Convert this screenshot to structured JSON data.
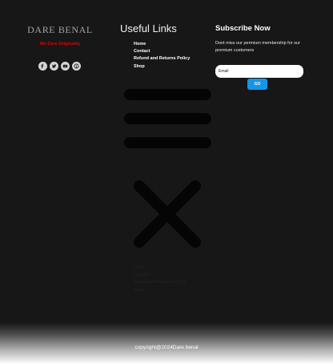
{
  "brand": {
    "name": "DARE BENAL",
    "tagline": "We Dare Originality"
  },
  "socials": [
    {
      "icon": "facebook-icon"
    },
    {
      "icon": "twitter-icon"
    },
    {
      "icon": "youtube-icon"
    },
    {
      "icon": "pinterest-icon"
    }
  ],
  "links": {
    "title": "Useful Links",
    "items": [
      {
        "label": "Home"
      },
      {
        "label": "Contact"
      },
      {
        "label": "Refund and Returns Policy"
      },
      {
        "label": "Shop"
      }
    ]
  },
  "subscribe": {
    "title": "Subscribe Now",
    "description": "Dont miss our permium membership for our premium customers",
    "email_placeholder": "Email",
    "button_label": "GO"
  },
  "mobile_menu": {
    "items": [
      {
        "label": "Home"
      },
      {
        "label": "Contact"
      },
      {
        "label": "Refund and Returns Policy"
      },
      {
        "label": "Shop"
      }
    ]
  },
  "footer": {
    "copyright": "copyright@2024Dare benal"
  },
  "colors": {
    "background": "#171717",
    "brand_tagline": "#e10000",
    "button": "#1595e8",
    "social_icon_bg": "#d4d4d4"
  }
}
